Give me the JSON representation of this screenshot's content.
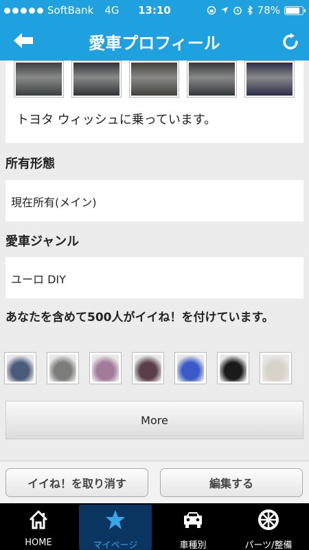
{
  "statusbar": {
    "carrier": "SoftBank",
    "network": "4G",
    "time": "13:10",
    "battery": "78%",
    "battery_level": 0.78
  },
  "header": {
    "title": "愛車プロフィール",
    "back_icon": "left-arrow-icon",
    "refresh_icon": "refresh-icon"
  },
  "car_photos": [
    {
      "color": "#3a4040"
    },
    {
      "color": "#2f3336"
    },
    {
      "color": "#42413a"
    },
    {
      "color": "#34373d"
    },
    {
      "color": "#2a2d4a"
    }
  ],
  "car_description": "トヨタ ウィッシュに乗っています。",
  "ownership": {
    "label": "所有形態",
    "value": "現在所有(メイン)"
  },
  "genre": {
    "label": "愛車ジャンル",
    "value": "ユーロ DIY"
  },
  "likes": {
    "label": "あなたを含めて500人がイイね！を付けています。",
    "thumbs": [
      {
        "color": "#4a5a7a"
      },
      {
        "color": "#7c7d7a"
      },
      {
        "color": "#a27a9a"
      },
      {
        "color": "#5a3f4a"
      },
      {
        "color": "#3a5ac8"
      },
      {
        "color": "#1a1a1a"
      },
      {
        "color": "#d8d2c8"
      }
    ]
  },
  "more_label": "More",
  "actions": {
    "unlike": "イイね！を取り消す",
    "edit": "編集する"
  },
  "tabs": [
    {
      "label": "HOME",
      "icon": "home-icon"
    },
    {
      "label": "マイページ",
      "icon": "star-icon"
    },
    {
      "label": "車種別",
      "icon": "car-icon"
    },
    {
      "label": "パーツ/整備",
      "icon": "wheel-icon"
    }
  ],
  "colors": {
    "header_blue": "#1fa1e0",
    "tab_active_bg": "#0a3560",
    "tab_active_text": "#3aa5e8"
  }
}
